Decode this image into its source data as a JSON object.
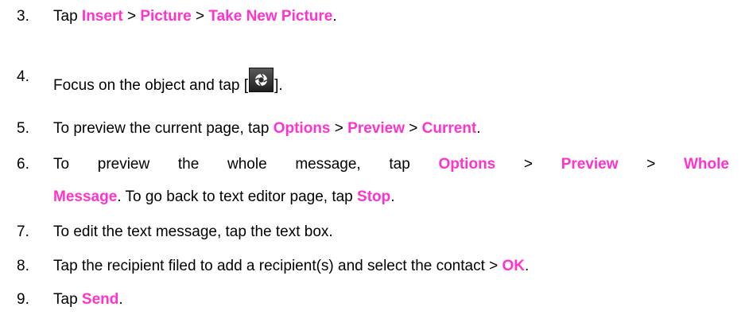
{
  "steps": [
    {
      "num": "3.",
      "parts": [
        {
          "t": "Tap "
        },
        {
          "t": "Insert",
          "k": 1
        },
        {
          "t": " > "
        },
        {
          "t": "Picture",
          "k": 1
        },
        {
          "t": " > "
        },
        {
          "t": "Take New Picture",
          "k": 1
        },
        {
          "t": "."
        }
      ]
    },
    {
      "num": "4.",
      "text_before": "Focus on the object and tap [",
      "icon": "camera-shutter-icon",
      "text_after": "]."
    },
    {
      "num": "5.",
      "parts": [
        {
          "t": "To preview the current page, tap "
        },
        {
          "t": "Options",
          "k": 1
        },
        {
          "t": " > "
        },
        {
          "t": "Preview",
          "k": 1
        },
        {
          "t": " > "
        },
        {
          "t": "Current",
          "k": 1
        },
        {
          "t": "."
        }
      ]
    },
    {
      "num": "6.",
      "line1": [
        {
          "t": "To"
        },
        {
          "t": "preview"
        },
        {
          "t": "the"
        },
        {
          "t": "whole"
        },
        {
          "t": "message,"
        },
        {
          "t": "tap"
        },
        {
          "t": "Options",
          "k": 1
        },
        {
          "t": ">"
        },
        {
          "t": "Preview",
          "k": 1
        },
        {
          "t": ">"
        },
        {
          "t": "Whole",
          "k": 1
        }
      ],
      "line2": [
        {
          "t": "Message",
          "k": 1
        },
        {
          "t": ". To go back to text editor page, tap "
        },
        {
          "t": "Stop",
          "k": 1
        },
        {
          "t": "."
        }
      ]
    },
    {
      "num": "7.",
      "parts": [
        {
          "t": "To edit the text message, tap the text box."
        }
      ]
    },
    {
      "num": "8.",
      "parts": [
        {
          "t": "Tap the recipient filed to add a recipient(s) and select the contact > "
        },
        {
          "t": "OK",
          "k": 1
        },
        {
          "t": "."
        }
      ]
    },
    {
      "num": "9.",
      "parts": [
        {
          "t": "Tap "
        },
        {
          "t": "Send",
          "k": 1
        },
        {
          "t": "."
        }
      ]
    }
  ],
  "colors": {
    "keyword": "#ff33cc",
    "text": "#000000"
  }
}
